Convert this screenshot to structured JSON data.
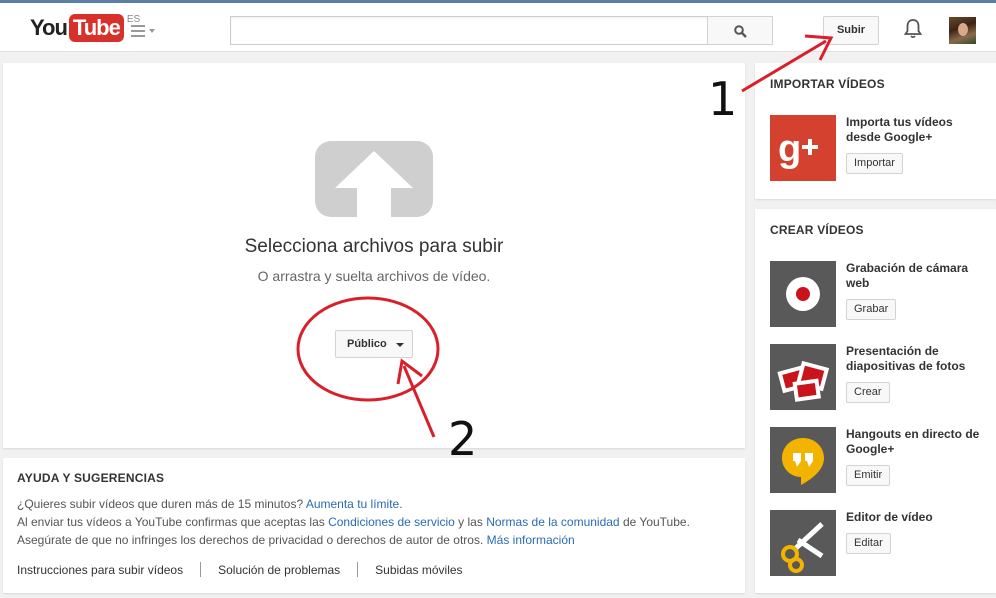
{
  "header": {
    "logo_you": "You",
    "logo_tube": "Tube",
    "logo_lang": "ES",
    "search_placeholder": "",
    "upload_label": "Subir"
  },
  "upload": {
    "title": "Selecciona archivos para subir",
    "subtitle": "O arrastra y suelta archivos de vídeo.",
    "privacy_label": "Público"
  },
  "help": {
    "title": "AYUDA Y SUGERENCIAS",
    "line1_text": "¿Quieres subir vídeos que duren más de 15 minutos?",
    "line1_link": "Aumenta tu límite.",
    "line2_pre": "Al enviar tus vídeos a YouTube confirmas que aceptas las",
    "line2_link1": "Condiciones de servicio",
    "line2_mid": "y las",
    "line2_link2": "Normas de la comunidad",
    "line2_post": "de YouTube.",
    "line3_text": "Asegúrate de que no infringes los derechos de privacidad o derechos de autor de otros.",
    "line3_link": "Más información",
    "links": [
      "Instrucciones para subir vídeos",
      "Solución de problemas",
      "Subidas móviles"
    ]
  },
  "import": {
    "title": "IMPORTAR VÍDEOS",
    "item": {
      "label": "Importa tus vídeos desde Google+",
      "button": "Importar",
      "icon": "google-plus-icon"
    }
  },
  "create": {
    "title": "CREAR VÍDEOS",
    "items": [
      {
        "label": "Grabación de cámara web",
        "button": "Grabar",
        "icon": "webcam-record-icon"
      },
      {
        "label": "Presentación de diapositivas de fotos",
        "button": "Crear",
        "icon": "photo-slideshow-icon"
      },
      {
        "label": "Hangouts en directo de Google+",
        "button": "Emitir",
        "icon": "hangouts-icon"
      },
      {
        "label": "Editor de vídeo",
        "button": "Editar",
        "icon": "video-editor-icon"
      }
    ]
  },
  "annotations": {
    "one": "1",
    "two": "2"
  },
  "colors": {
    "youtube_red": "#d8302a",
    "link_blue": "#2a6bb5",
    "annotation_red": "#d9202a",
    "google_plus_red": "#d5412f",
    "hangouts_yellow": "#f3b400"
  }
}
